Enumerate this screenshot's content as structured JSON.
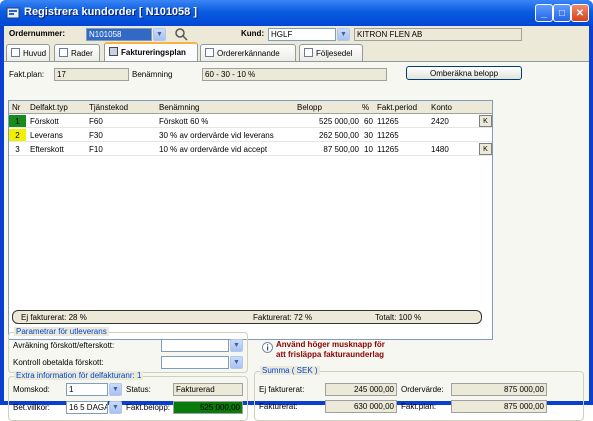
{
  "window": {
    "title": "Registrera kundorder [ N101058 ]",
    "controls": [
      "minimize",
      "maximize",
      "close"
    ]
  },
  "header": {
    "order_label": "Ordernummer:",
    "order_value": "N101058",
    "customer_label": "Kund:",
    "customer_code": "HGLF",
    "customer_name": "KITRON FLEN AB"
  },
  "tabs": [
    {
      "label": "Huvud",
      "icon": "document-icon"
    },
    {
      "label": "Rader",
      "icon": "rows-icon"
    },
    {
      "label": "Faktureringsplan",
      "icon": "car-icon",
      "active": true
    },
    {
      "label": "Ordererkännande",
      "icon": "document-icon"
    },
    {
      "label": "Följesedel",
      "icon": "document-icon"
    }
  ],
  "plan": {
    "plan_label": "Fakt.plan:",
    "plan_value": "17",
    "name_label": "Benämning",
    "name_value": "60 - 30 - 10 %",
    "recalc_button": "Omberäkna belopp"
  },
  "grid": {
    "headers": [
      "Nr",
      "Delfakt.typ",
      "Tjänstekod",
      "Benämning",
      "Belopp",
      "%",
      "Fakt.period",
      "Konto"
    ],
    "rows": [
      {
        "nr": "1",
        "type": "Förskott",
        "code": "F60",
        "desc": "Förskott 60 %",
        "amount": "525 000,00",
        "pct": "60",
        "period": "11265",
        "account": "2420",
        "k": "K",
        "status_color": "#1a8a1a"
      },
      {
        "nr": "2",
        "type": "Leverans",
        "code": "F30",
        "desc": "30 % av ordervärde vid leverans",
        "amount": "262 500,00",
        "pct": "30",
        "period": "11265",
        "account": "",
        "k": "",
        "status_color": "#f0f000"
      },
      {
        "nr": "3",
        "type": "Efterskott",
        "code": "F10",
        "desc": "10 %  av ordervärde vid accept",
        "amount": "87 500,00",
        "pct": "10",
        "period": "11265",
        "account": "1480",
        "k": "K",
        "status_color": ""
      }
    ]
  },
  "status": {
    "not_invoiced": "Ej fakturerat:  28 %",
    "invoiced": "Fakturerat: 72 %",
    "total": "Totalt: 100 %"
  },
  "delivery_params": {
    "title": "Parametrar för utleverans",
    "advance_label": "Avräkning förskott/efterskott:",
    "check_label": "Kontroll obetalda förskott:"
  },
  "extra": {
    "title": "Extra information för delfakturanr:  1",
    "vat_label": "Momskod:",
    "vat_value": "1",
    "status_label": "Status:",
    "status_value": "Fakturerad",
    "terms_label": "Bet.villkor:",
    "terms_value": "16  5 DAGA",
    "amount_label": "Fakt.belopp:",
    "amount_value": "525 000,00",
    "amount_bg": "#0a7a0a"
  },
  "hint": {
    "line1": "Använd höger musknapp för",
    "line2": "att frisläppa fakturaunderlag",
    "color": "#8b0000"
  },
  "summary": {
    "title": "Summa  ( SEK )",
    "not_invoiced_label": "Ej fakturerat:",
    "not_invoiced_value": "245 000,00",
    "order_value_label": "Ordervärde:",
    "order_value_value": "875 000,00",
    "invoiced_label": "Fakturerat:",
    "invoiced_value": "630 000,00",
    "plan_label": "Fakt.plan:",
    "plan_value": "875 000,00"
  }
}
